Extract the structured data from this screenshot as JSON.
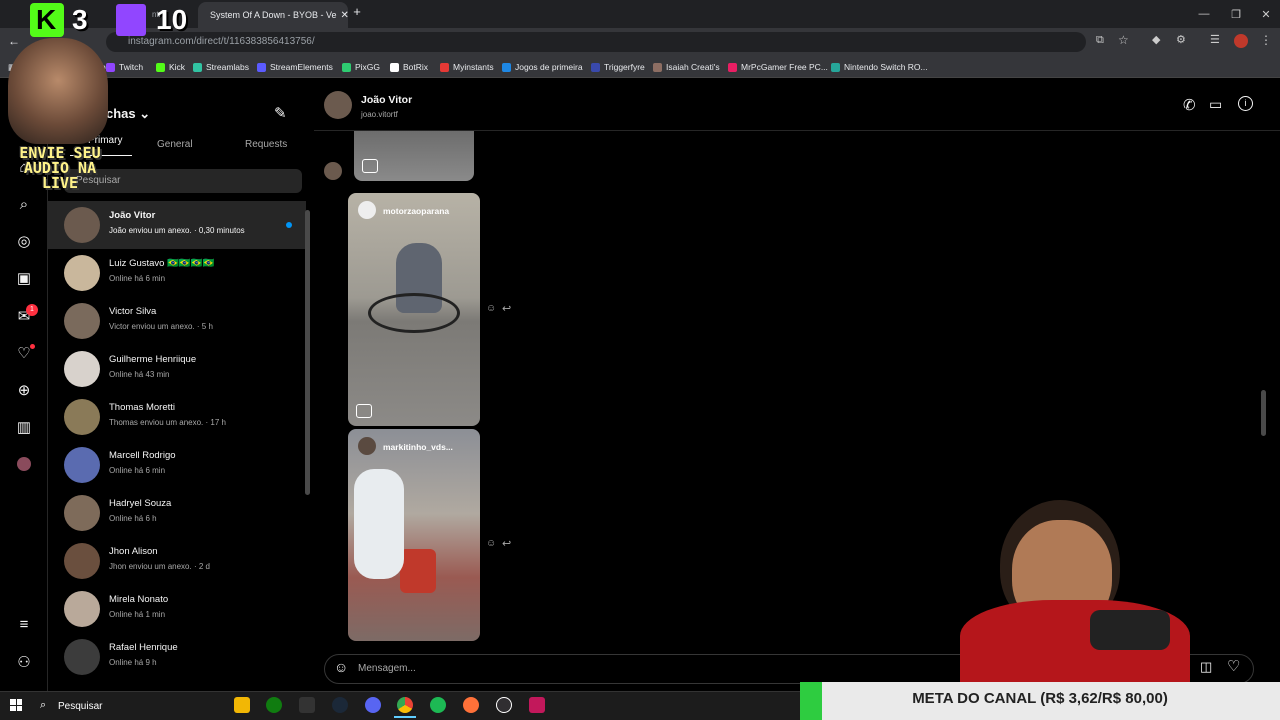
{
  "browser": {
    "tab_prev_label": "ntra",
    "tab_title": "System Of A Down - BYOB - Ve",
    "new_tab": "+",
    "url": "instagram.com/direct/t/116383856413756/",
    "bookmarks": [
      {
        "label": "YouTube",
        "color": "#ff0000"
      },
      {
        "label": "Twitch",
        "color": "#9146ff"
      },
      {
        "label": "Kick",
        "color": "#53fc18"
      },
      {
        "label": "Streamlabs",
        "color": "#31c3a2"
      },
      {
        "label": "StreamElements",
        "color": "#5b5bff"
      },
      {
        "label": "PixGG",
        "color": "#2ecc71"
      },
      {
        "label": "BotRix",
        "color": "#ffffff"
      },
      {
        "label": "Myinstants",
        "color": "#e53935"
      },
      {
        "label": "Jogos de primeira",
        "color": "#1e88e5"
      },
      {
        "label": "Triggerfyre",
        "color": "#3949ab"
      },
      {
        "label": "Isaiah Creati's",
        "color": "#8d6e63"
      },
      {
        "label": "MrPcGamer Free PC...",
        "color": "#e91e63"
      },
      {
        "label": "Nintendo Switch RO...",
        "color": "#26a69a"
      }
    ]
  },
  "overlay": {
    "kick_count": "3",
    "twitch_count": "10",
    "envie_text": "ENVIE SEU AUDIO NA LIVE"
  },
  "inbox": {
    "title": "chas",
    "tabs": [
      "Primary",
      "General",
      "Requests"
    ],
    "search_placeholder": "Pesquisar",
    "conversations": [
      {
        "name": "João Vitor",
        "sub": "João enviou um anexo. · 0,30 minutos",
        "unread": true,
        "color": "#6b5a4e"
      },
      {
        "name": "Luiz Gustavo 🇧🇷🇧🇷🇧🇷🇧🇷",
        "sub": "Online há 6 min",
        "color": "#c9b79c"
      },
      {
        "name": "Victor Silva",
        "sub": "Victor enviou um anexo. · 5 h",
        "color": "#7a6a5c"
      },
      {
        "name": "Guilherme Henriique",
        "sub": "Online há 43 min",
        "color": "#d8d2cc"
      },
      {
        "name": "Thomas Moretti",
        "sub": "Thomas enviou um anexo. · 17 h",
        "color": "#8a7a58"
      },
      {
        "name": "Marcell Rodrigo",
        "sub": "Online há 6 min",
        "color": "#5a6bb0"
      },
      {
        "name": "Hadryel Souza",
        "sub": "Online há 6 h",
        "color": "#7e6b5a"
      },
      {
        "name": "Jhon Alison",
        "sub": "Jhon enviou um anexo. · 2 d",
        "color": "#6a4f3e"
      },
      {
        "name": "Mirela Nonato",
        "sub": "Online há 1 min",
        "color": "#b9a99a"
      },
      {
        "name": "Rafael Henrique",
        "sub": "Online há 9 h",
        "color": "#3c3c3c"
      }
    ]
  },
  "chat": {
    "contact_name": "João Vitor",
    "contact_handle": "joao.vitortf",
    "reels": [
      {
        "author": "motorzaoparana"
      },
      {
        "author": "markitinho_vds..."
      }
    ],
    "composer_placeholder": "Mensagem..."
  },
  "taskbar": {
    "search_label": "Pesquisar"
  },
  "meta_goal": {
    "text": "META DO CANAL (R$ 3,62/R$ 80,00)",
    "current": 3.62,
    "target": 80.0
  },
  "badges": {
    "notifications": "1"
  }
}
